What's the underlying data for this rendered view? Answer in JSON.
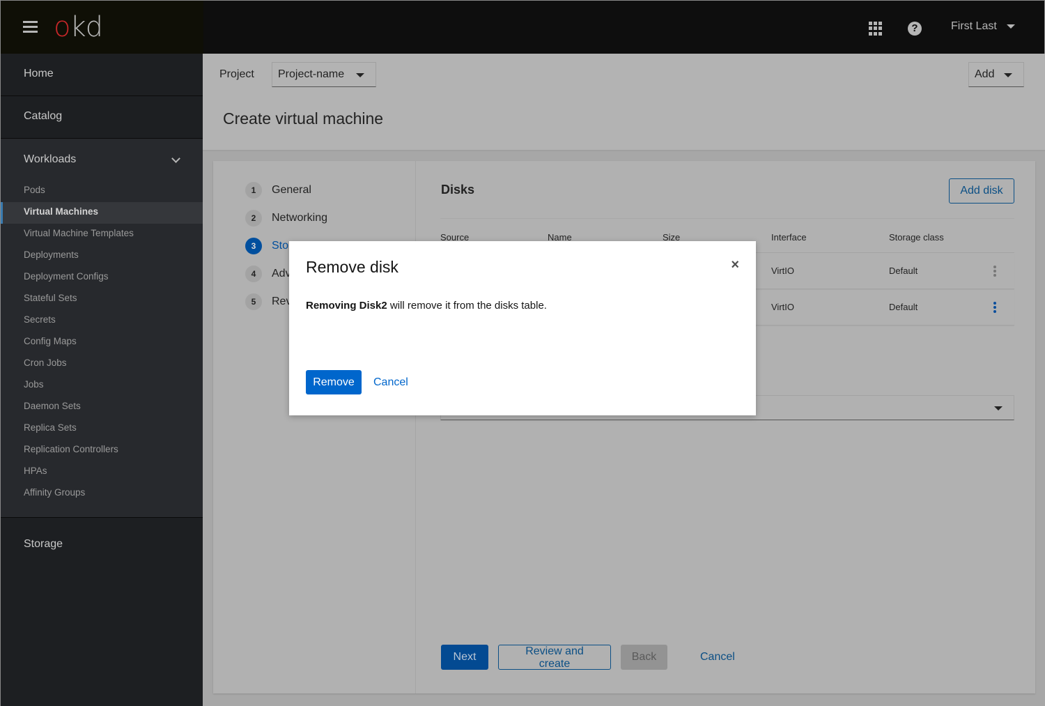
{
  "masthead": {
    "logo_o": "o",
    "logo_kd": "kd",
    "user_name": "First Last",
    "icons": [
      "hamburger-icon",
      "app-launcher-icon",
      "help-icon",
      "caret-down-icon"
    ]
  },
  "sidebar": {
    "home": "Home",
    "catalog": "Catalog",
    "workloads": {
      "label": "Workloads",
      "expanded": true,
      "items": [
        {
          "label": "Pods",
          "active": false
        },
        {
          "label": "Virtual Machines",
          "active": true
        },
        {
          "label": "Virtual Machine Templates",
          "active": false
        },
        {
          "label": "Deployments",
          "active": false
        },
        {
          "label": "Deployment Configs",
          "active": false
        },
        {
          "label": "Stateful Sets",
          "active": false
        },
        {
          "label": "Secrets",
          "active": false
        },
        {
          "label": "Config Maps",
          "active": false
        },
        {
          "label": "Cron Jobs",
          "active": false
        },
        {
          "label": "Jobs",
          "active": false
        },
        {
          "label": "Daemon Sets",
          "active": false
        },
        {
          "label": "Replica Sets",
          "active": false
        },
        {
          "label": "Replication Controllers",
          "active": false
        },
        {
          "label": "HPAs",
          "active": false
        },
        {
          "label": "Affinity Groups",
          "active": false
        }
      ]
    },
    "storage": "Storage"
  },
  "page": {
    "project_label": "Project",
    "project_value": "Project-name",
    "add_label": "Add",
    "title": "Create virtual machine"
  },
  "wizard": {
    "steps": [
      {
        "num": "1",
        "label": "General"
      },
      {
        "num": "2",
        "label": "Networking"
      },
      {
        "num": "3",
        "label": "Storage",
        "current": true
      },
      {
        "num": "4",
        "label": "Advanced"
      },
      {
        "num": "5",
        "label": "Review"
      }
    ],
    "disks_title": "Disks",
    "add_disk_label": "Add disk",
    "table": {
      "columns": [
        "Source",
        "Name",
        "Size",
        "Interface",
        "Storage class"
      ],
      "rows": [
        {
          "interface": "VirtIO",
          "storage_class": "Default"
        },
        {
          "interface": "VirtIO",
          "storage_class": "Default"
        }
      ]
    },
    "footer": {
      "next": "Next",
      "review": "Review and create",
      "back": "Back",
      "cancel": "Cancel"
    }
  },
  "modal": {
    "title": "Remove disk",
    "body_bold": "Removing Disk2",
    "body_rest": " will remove it from the disks table.",
    "remove_label": "Remove",
    "cancel_label": "Cancel",
    "close_glyph": "×"
  },
  "colors": {
    "primary": "#0066cc",
    "brand_red": "#c62729",
    "active_nav_marker": "#3a7bb0"
  }
}
